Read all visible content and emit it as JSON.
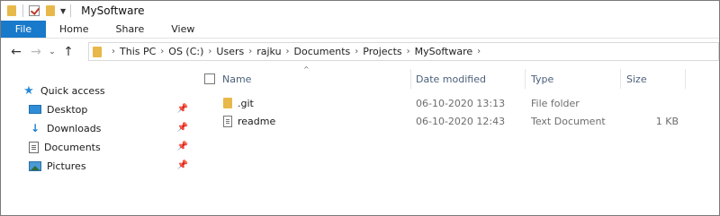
{
  "window": {
    "title": "MySoftware"
  },
  "quick_access_toolbar": {
    "icons": [
      "folder-icon",
      "properties-check-icon",
      "new-folder-icon",
      "customize-dropdown-icon"
    ]
  },
  "ribbon": {
    "tabs": [
      {
        "label": "File",
        "active": true,
        "color": "#1979ca"
      },
      {
        "label": "Home"
      },
      {
        "label": "Share"
      },
      {
        "label": "View"
      }
    ]
  },
  "navigation": {
    "back": "←",
    "forward": "→",
    "recent": "⌄",
    "up": "↑",
    "breadcrumb": [
      "This PC",
      "OS (C:)",
      "Users",
      "rajku",
      "Documents",
      "Projects",
      "MySoftware"
    ],
    "separator": "›"
  },
  "sidebar": {
    "quick_access_label": "Quick access",
    "items": [
      {
        "label": "Desktop",
        "icon": "desktop-icon",
        "pinned": true
      },
      {
        "label": "Downloads",
        "icon": "downloads-icon",
        "pinned": true
      },
      {
        "label": "Documents",
        "icon": "documents-icon",
        "pinned": true
      },
      {
        "label": "Pictures",
        "icon": "pictures-icon",
        "pinned": true
      }
    ],
    "pin_glyph": "📌"
  },
  "file_list": {
    "sort_indicator": "^",
    "columns": [
      "Name",
      "Date modified",
      "Type",
      "Size"
    ],
    "rows": [
      {
        "name": ".git",
        "date": "06-10-2020 13:13",
        "type": "File folder",
        "size": "",
        "icon": "folder-icon"
      },
      {
        "name": "readme",
        "date": "06-10-2020 12:43",
        "type": "Text Document",
        "size": "1 KB",
        "icon": "text-document-icon"
      }
    ]
  },
  "colors": {
    "accent": "#1979ca",
    "folder": "#e8b84a",
    "header_text": "#4c607a"
  }
}
